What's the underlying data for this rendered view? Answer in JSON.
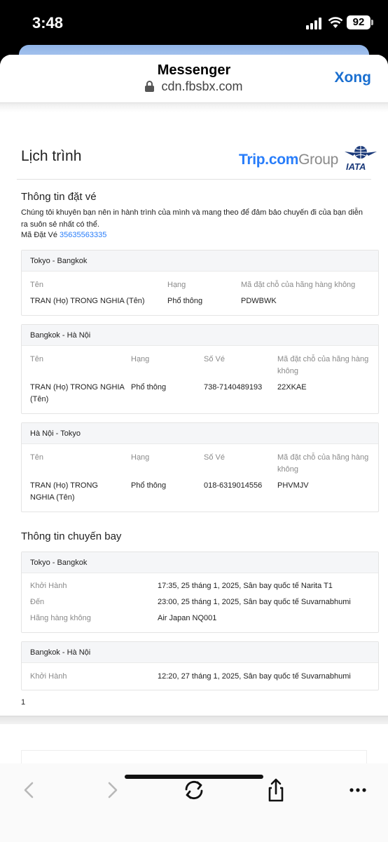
{
  "status_bar": {
    "time": "3:48",
    "battery": "92"
  },
  "browser": {
    "title": "Messenger",
    "url": "cdn.fbsbx.com",
    "done_label": "Xong"
  },
  "doc": {
    "title": "Lịch trình",
    "logo": {
      "trip": "Trip.com",
      "group": "Group"
    },
    "iata_label": "IATA",
    "booking": {
      "title": "Thông tin đặt vé",
      "note": "Chúng tôi khuyên bạn nên in hành trình của mình và mang theo để đảm bảo chuyến đi của bạn diễn ra suôn sẻ nhất có thể.",
      "code_label": "Mã Đặt Vé",
      "code_value": "35635563335"
    },
    "tickets": [
      {
        "route": "Tokyo - Bangkok",
        "headers": [
          "Tên",
          "Hạng",
          "Mã đặt chỗ của hãng hàng không"
        ],
        "values": [
          "TRAN (Họ) TRONG NGHIA (Tên)",
          "Phổ thông",
          "PDWBWK"
        ]
      },
      {
        "route": "Bangkok - Hà Nội",
        "headers": [
          "Tên",
          "Hạng",
          "Số Vé",
          "Mã đặt chỗ của hãng hàng không"
        ],
        "values": [
          "TRAN (Họ) TRONG NGHIA (Tên)",
          "Phổ thông",
          "738-7140489193",
          "22XKAE"
        ]
      },
      {
        "route": "Hà Nội - Tokyo",
        "headers": [
          "Tên",
          "Hạng",
          "Số Vé",
          "Mã đặt chỗ của hãng hàng không"
        ],
        "values": [
          "TRAN (Họ) TRONG NGHIA (Tên)",
          "Phổ thông",
          "018-6319014556",
          "PHVMJV"
        ]
      }
    ],
    "flights": {
      "title": "Thông tin chuyến bay",
      "items": [
        {
          "route": "Tokyo - Bangkok",
          "rows": [
            {
              "label": "Khởi Hành",
              "value": "17:35, 25 tháng 1, 2025, Sân bay quốc tế Narita T1"
            },
            {
              "label": "Đến",
              "value": "23:00, 25 tháng 1, 2025, Sân bay quốc tế Suvarnabhumi"
            },
            {
              "label": "Hãng hàng không",
              "value": "Air Japan NQ001"
            }
          ]
        },
        {
          "route": "Bangkok - Hà Nội",
          "rows": [
            {
              "label": "Khởi Hành",
              "value": "12:20, 27 tháng 1, 2025, Sân bay quốc tế Suvarnabhumi"
            }
          ]
        }
      ]
    },
    "page_number": "1"
  },
  "toolbar": {
    "icons": [
      "back-icon",
      "forward-icon",
      "reload-icon",
      "share-icon",
      "more-icon"
    ]
  },
  "colors": {
    "accent": "#1a6fd0",
    "link": "#287dfa",
    "trip_blue": "#287dfa",
    "iata_blue": "#1b3a7a"
  }
}
